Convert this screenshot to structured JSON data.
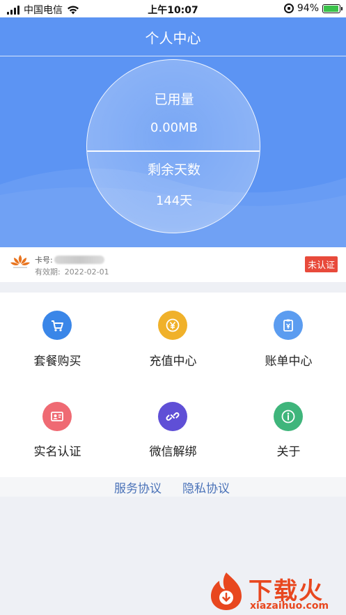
{
  "status_bar": {
    "carrier": "中国电信",
    "time": "上午10:07",
    "battery": "94%",
    "battery_level": 0.94
  },
  "header": {
    "title": "个人中心",
    "used_label": "已用量",
    "used_value": "0.00MB",
    "remaining_label": "剩余天数",
    "remaining_value": "144天"
  },
  "card": {
    "number_label": "卡号:",
    "validity_label": "有效期:",
    "validity_date": "2022-02-01",
    "status_badge": "未认证"
  },
  "menu": [
    {
      "label": "套餐购买",
      "icon": "cart-icon",
      "color": "#3a86e8"
    },
    {
      "label": "充值中心",
      "icon": "yen-coin-icon",
      "color": "#f0b12a"
    },
    {
      "label": "账单中心",
      "icon": "bill-icon",
      "color": "#5b9cf0"
    },
    {
      "label": "实名认证",
      "icon": "id-card-icon",
      "color": "#ef6a73"
    },
    {
      "label": "微信解绑",
      "icon": "unlink-icon",
      "color": "#5f4fd6"
    },
    {
      "label": "关于",
      "icon": "info-icon",
      "color": "#3fb57b"
    }
  ],
  "footer_links": {
    "service": "服务协议",
    "privacy": "隐私协议"
  },
  "watermark": {
    "text": "下载火",
    "domain": "xiazaihuo.com"
  },
  "colors": {
    "header_bg": "#5c94f3",
    "badge_bg": "#e84a3b",
    "link": "#4a72b8"
  }
}
